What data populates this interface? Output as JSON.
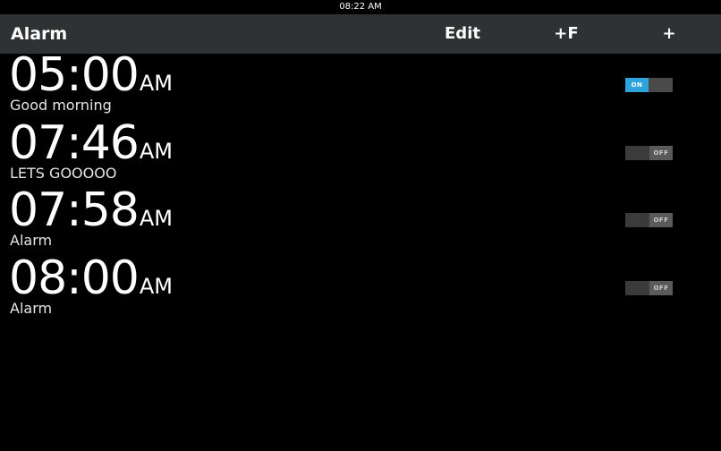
{
  "status_bar": {
    "time": "08:22 AM"
  },
  "action_bar": {
    "title": "Alarm",
    "edit_label": "Edit",
    "add_favorite_label": "+F",
    "add_label": "+"
  },
  "alarms": [
    {
      "time": "05:00",
      "period": "AM",
      "label": "Good morning",
      "state": "ON",
      "enabled": true
    },
    {
      "time": "07:46",
      "period": "AM",
      "label": "LETS GOOOOO",
      "state": "OFF",
      "enabled": false
    },
    {
      "time": "07:58",
      "period": "AM",
      "label": "Alarm",
      "state": "OFF",
      "enabled": false
    },
    {
      "time": "08:00",
      "period": "AM",
      "label": "Alarm",
      "state": "OFF",
      "enabled": false
    }
  ],
  "colors": {
    "accent_on": "#2ea3dc",
    "action_bar_bg": "#2f3132",
    "background": "#000000"
  }
}
